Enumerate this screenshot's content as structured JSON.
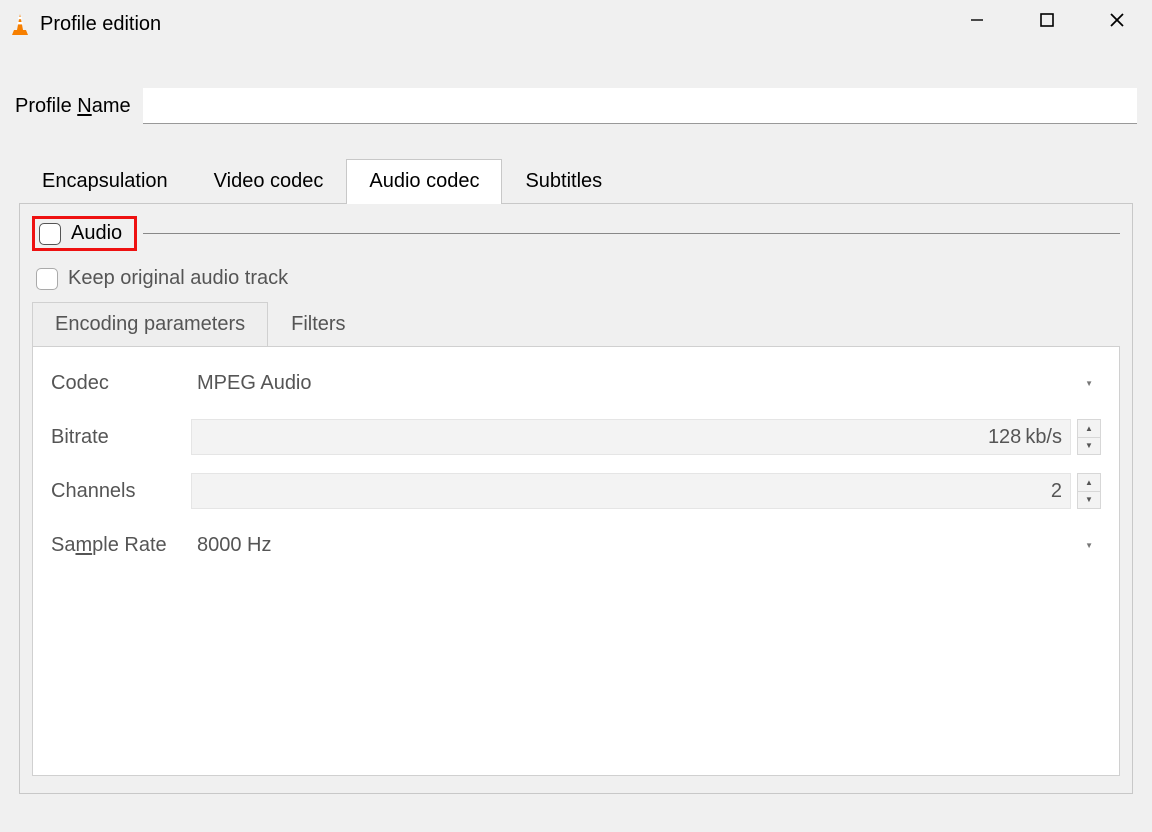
{
  "window": {
    "title": "Profile edition"
  },
  "profile": {
    "label_pre": "Profile ",
    "label_u": "N",
    "label_post": "ame",
    "value": ""
  },
  "tabs": {
    "encapsulation": "Encapsulation",
    "video_codec": "Video codec",
    "audio_codec": "Audio codec",
    "subtitles": "Subtitles"
  },
  "audio": {
    "group_label": "Audio",
    "keep_original": "Keep original audio track",
    "subtabs": {
      "encoding": "Encoding parameters",
      "filters": "Filters"
    },
    "fields": {
      "codec_label": "Codec",
      "codec_value": "MPEG Audio",
      "bitrate_label": "Bitrate",
      "bitrate_value": "128",
      "bitrate_suffix": "kb/s",
      "channels_label": "Channels",
      "channels_value": "2",
      "samplerate_label_pre": "Sa",
      "samplerate_label_u": "m",
      "samplerate_label_post": "ple Rate",
      "samplerate_value": "8000 Hz"
    }
  }
}
